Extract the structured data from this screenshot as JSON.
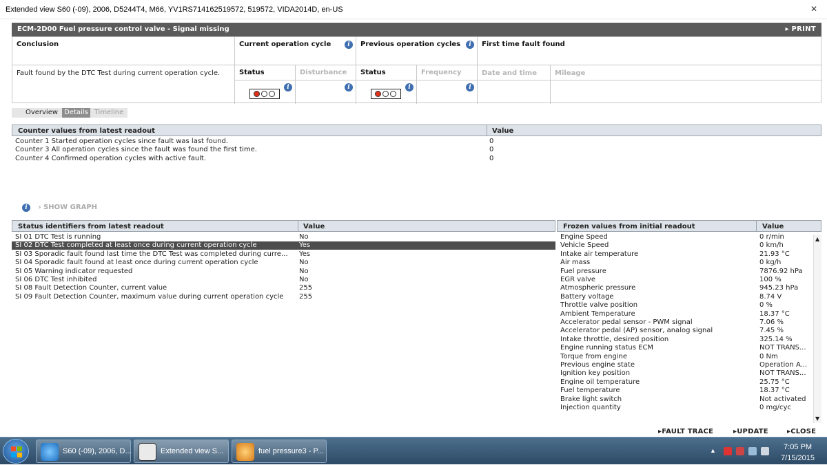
{
  "window": {
    "title": "Extended view   S60 (-09), 2006, D5244T4, M66, YV1RS714162519572, 519572, VIDA2014D, en-US",
    "close": "✕"
  },
  "fault": {
    "title": "ECM-2D00 Fuel pressure control valve - Signal missing",
    "print": "PRINT"
  },
  "grid": {
    "conclusion_label": "Conclusion",
    "conclusion_text": "Fault found by the DTC Test during current operation cycle.",
    "current_cycle": "Current operation cycle",
    "previous_cycles": "Previous operation cycles",
    "first_time": "First time fault found",
    "status": "Status",
    "disturbance": "Disturbance",
    "status2": "Status",
    "frequency": "Frequency",
    "date_time": "Date and time",
    "mileage": "Mileage"
  },
  "tabs": [
    "Overview",
    "Details",
    "Timeline"
  ],
  "counters": {
    "header": "Counter values from latest readout",
    "value_header": "Value",
    "rows": [
      {
        "name": "Counter 1 Started operation cycles since fault was last found.",
        "value": "0"
      },
      {
        "name": "Counter 3 All operation cycles since the fault was found the first time.",
        "value": "0"
      },
      {
        "name": "Counter 4 Confirmed operation cycles with active fault.",
        "value": "0"
      }
    ]
  },
  "show_graph": "SHOW GRAPH",
  "status_ids": {
    "header": "Status identifiers from latest readout",
    "value_header": "Value",
    "rows": [
      {
        "name": "SI 01 DTC Test is running",
        "value": "No"
      },
      {
        "name": "SI 02 DTC Test completed at least once during current operation cycle",
        "value": "Yes"
      },
      {
        "name": "SI 03 Sporadic fault found last time the DTC Test was completed during curre...",
        "value": "Yes"
      },
      {
        "name": "SI 04 Sporadic fault found at least once during current operation cycle",
        "value": "No"
      },
      {
        "name": "SI 05 Warning indicator requested",
        "value": "No"
      },
      {
        "name": "SI 06 DTC Test inhibited",
        "value": "No"
      },
      {
        "name": "SI 08 Fault Detection Counter, current value",
        "value": "255"
      },
      {
        "name": "SI 09 Fault Detection Counter, maximum value during current operation cycle",
        "value": "255"
      }
    ]
  },
  "frozen": {
    "header": "Frozen values from initial readout",
    "value_header": "Value",
    "rows": [
      {
        "name": "Engine Speed",
        "value": "0 r/min"
      },
      {
        "name": "Vehicle Speed",
        "value": "0 km/h"
      },
      {
        "name": "Intake air temperature",
        "value": "21.93 °C"
      },
      {
        "name": "Air mass",
        "value": "0 kg/h"
      },
      {
        "name": "Fuel pressure",
        "value": "7876.92 hPa"
      },
      {
        "name": "EGR valve",
        "value": "100 %"
      },
      {
        "name": "Atmospheric pressure",
        "value": "945.23 hPa"
      },
      {
        "name": "Battery voltage",
        "value": "8.74 V"
      },
      {
        "name": "Throttle valve position",
        "value": "0 %"
      },
      {
        "name": "Ambient Temperature",
        "value": "18.37 °C"
      },
      {
        "name": "Accelerator pedal sensor - PWM signal",
        "value": "7.06 %"
      },
      {
        "name": "Accelerator pedal (AP) sensor, analog signal",
        "value": "7.45 %"
      },
      {
        "name": "Intake throttle, desired position",
        "value": "325.14 %"
      },
      {
        "name": "Engine running status ECM",
        "value": "NOT TRANS..."
      },
      {
        "name": "Torque from engine",
        "value": "0 Nm"
      },
      {
        "name": "Previous engine state",
        "value": "Operation A..."
      },
      {
        "name": "Ignition key position",
        "value": "NOT TRANS..."
      },
      {
        "name": "Engine oil temperature",
        "value": "25.75 °C"
      },
      {
        "name": "Fuel temperature",
        "value": "18.37 °C"
      },
      {
        "name": "Brake light switch",
        "value": "Not activated"
      },
      {
        "name": "Injection quantity",
        "value": "0 mg/cyc"
      }
    ]
  },
  "actions": {
    "fault_trace": "FAULT TRACE",
    "update": "UPDATE",
    "close": "CLOSE"
  },
  "taskbar": {
    "items": [
      "S60 (-09), 2006, D...",
      "Extended view   S...",
      "fuel pressure3 - P..."
    ],
    "time": "7:05 PM",
    "date": "7/15/2015"
  },
  "colors": {
    "header_bar": "#5b5b5b",
    "selected_row": "#4d4d4d",
    "info_icon": "#3f6fb0",
    "fault_light": "#e0311c",
    "taskbar": "#2d4a66"
  }
}
